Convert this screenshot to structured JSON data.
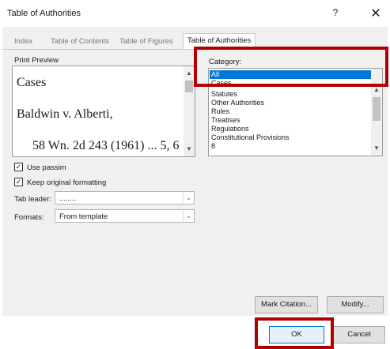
{
  "window": {
    "title": "Table of Authorities",
    "help_glyph": "?",
    "close_glyph": "✕"
  },
  "tabs": [
    {
      "label": "Index",
      "active": false
    },
    {
      "label": "Table of Contents",
      "active": false
    },
    {
      "label": "Table of Figures",
      "active": false
    },
    {
      "label": "Table of Authorities",
      "active": true
    }
  ],
  "print_preview": {
    "label": "Print Preview",
    "lines": [
      "Cases",
      "Baldwin v. Alberti,",
      "58 Wn. 2d 243 (1961) ... 5, 6"
    ]
  },
  "category": {
    "label": "Category:",
    "items": [
      "All",
      "Cases",
      "Statutes",
      "Other Authorities",
      "Rules",
      "Treatises",
      "Regulations",
      "Constitutional Provisions",
      "8"
    ],
    "selected": "All"
  },
  "options": {
    "use_passim": {
      "label": "Use passim",
      "checked": true
    },
    "keep_formatting": {
      "label": "Keep original formatting",
      "checked": true
    },
    "check_glyph": "✓"
  },
  "tab_leader": {
    "label": "Tab leader:",
    "value": "........"
  },
  "formats": {
    "label": "Formats:",
    "value": "From template"
  },
  "buttons": {
    "mark_citation": "Mark Citation...",
    "modify": "Modify...",
    "ok": "OK",
    "cancel": "Cancel"
  },
  "glyphs": {
    "up": "▲",
    "down": "▼",
    "caret": "⌄"
  },
  "highlight_color": "#b00000",
  "selection_color": "#0078d7"
}
